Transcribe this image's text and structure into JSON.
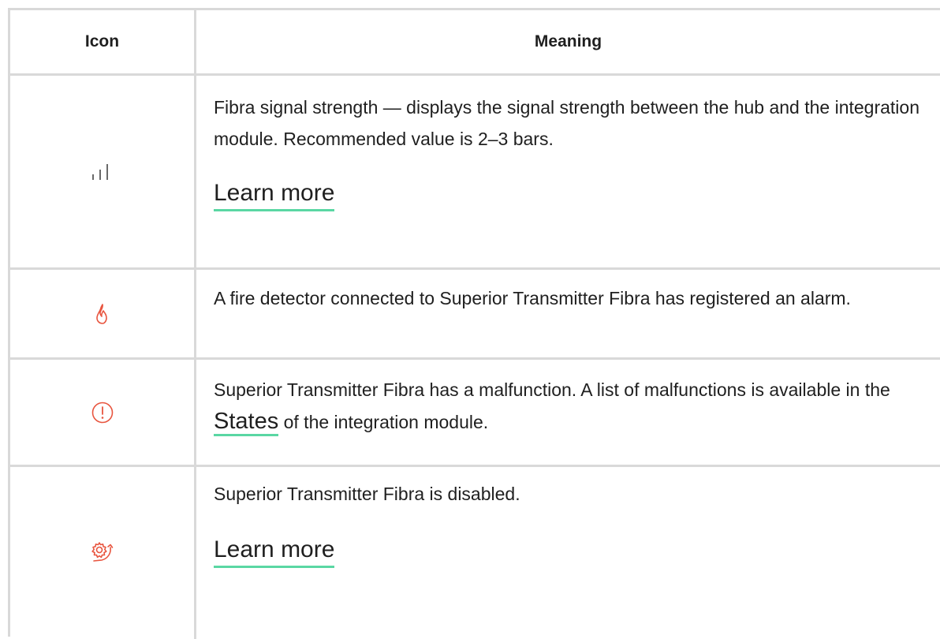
{
  "table": {
    "header": {
      "icon": "Icon",
      "meaning": "Meaning"
    },
    "rows": [
      {
        "icon": "signal-strength-icon",
        "text": "Fibra signal strength — displays the signal strength between the hub and the integration module. Recommended value is 2–3 bars.",
        "link": "Learn more"
      },
      {
        "icon": "fire-icon",
        "text": "A fire detector connected to Superior Transmitter Fibra has registered an alarm."
      },
      {
        "icon": "alert-icon",
        "text_before": "Superior Transmitter Fibra has a malfunction. A list of malfunctions is available in the",
        "link": "States",
        "text_after": "of the integration module."
      },
      {
        "icon": "device-disabled-icon",
        "text": "Superior Transmitter Fibra is disabled.",
        "link": "Learn more"
      }
    ]
  },
  "colors": {
    "accent_underline": "#5ad7a3",
    "icon_red": "#e8553f",
    "border": "#d9d9d9"
  }
}
